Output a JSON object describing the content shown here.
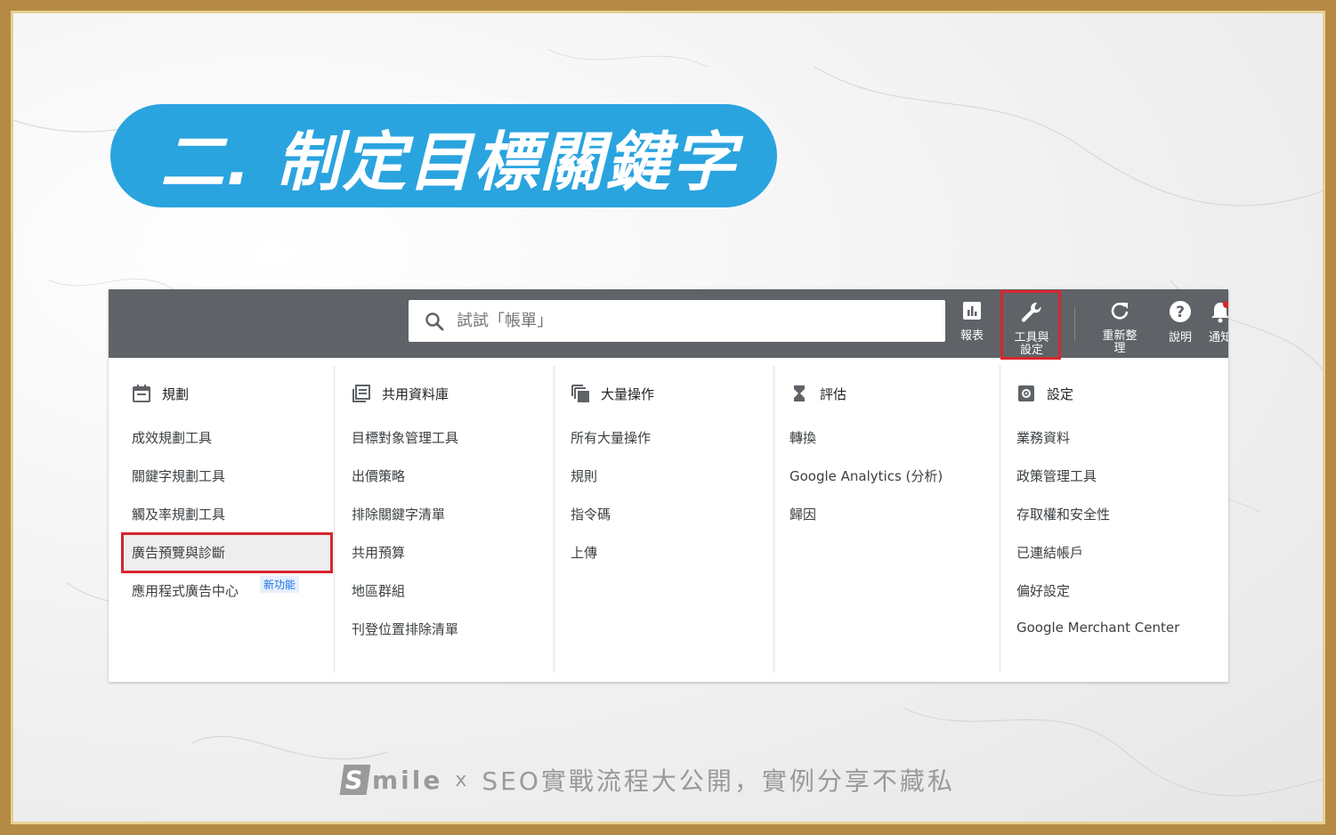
{
  "slide": {
    "title": "二. 制定目標關鍵字",
    "footer_brand_s": "S",
    "footer_brand_rest": "mile",
    "footer_x": "x",
    "footer_caption": "SEO實戰流程大公開，實例分享不藏私"
  },
  "topbar": {
    "search_placeholder": "試試「帳單」",
    "reports_label": "報表",
    "tools_label": "工具與設定",
    "refresh_label": "重新整理",
    "help_label": "說明",
    "notifications_label": "通知"
  },
  "menu": {
    "columns": [
      {
        "heading": "規劃",
        "items": [
          "成效規劃工具",
          "關鍵字規劃工具",
          "觸及率規劃工具",
          "廣告預覽與診斷",
          "應用程式廣告中心"
        ],
        "badge": "新功能"
      },
      {
        "heading": "共用資料庫",
        "items": [
          "目標對象管理工具",
          "出價策略",
          "排除關鍵字清單",
          "共用預算",
          "地區群組",
          "刊登位置排除清單"
        ]
      },
      {
        "heading": "大量操作",
        "items": [
          "所有大量操作",
          "規則",
          "指令碼",
          "上傳"
        ]
      },
      {
        "heading": "評估",
        "items": [
          "轉換",
          "Google Analytics (分析)",
          "歸因"
        ]
      },
      {
        "heading": "設定",
        "items": [
          "業務資料",
          "政策管理工具",
          "存取權和安全性",
          "已連結帳戶",
          "偏好設定",
          "Google Merchant Center"
        ]
      }
    ]
  },
  "colors": {
    "title_pill": "#2aa4df",
    "topbar": "#5f6368",
    "highlight": "#d7262e",
    "frame": "#b48a45"
  }
}
